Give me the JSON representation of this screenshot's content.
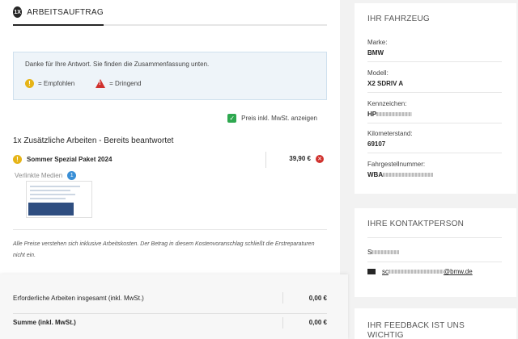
{
  "tab": {
    "badge": "1X",
    "label": "ARBEITSAUFTRAG"
  },
  "info": {
    "text": "Danke für Ihre Antwort. Sie finden die Zusammenfassung unten.",
    "legend_recommended": "= Empfohlen",
    "legend_urgent": "= Dringend"
  },
  "vat_toggle": {
    "label": "Preis inkl. MwSt. anzeigen",
    "checked": true
  },
  "section_title": "1x Zusätzliche Arbeiten - Bereits beantwortet",
  "item": {
    "name": "Sommer Spezial Paket 2024",
    "price": "39,90 €",
    "linked_media_label": "Verlinkte Medien",
    "linked_media_count": "1"
  },
  "footnote": "Alle Preise verstehen sich inklusive Arbeitskosten. Der Betrag in diesem Kostenvoranschlag schließt die Erstreparaturen nicht ein.",
  "totals": {
    "required_label": "Erforderliche Arbeiten insgesamt (inkl. MwSt.)",
    "required_value": "0,00 €",
    "sum_label": "Summe (inkl. MwSt.)",
    "sum_value": "0,00 €"
  },
  "vehicle": {
    "title": "IHR FAHRZEUG",
    "fields": [
      {
        "label": "Marke:",
        "value": "BMW"
      },
      {
        "label": "Modell:",
        "value": "X2 SDRIV A"
      },
      {
        "label": "Kennzeichen:",
        "value": "HP"
      },
      {
        "label": "Kilometerstand:",
        "value": "69107"
      },
      {
        "label": "Fahrgestellnummer:",
        "value": "WBA"
      }
    ]
  },
  "contact": {
    "title": "IHRE KONTAKTPERSON",
    "name": "S",
    "email_prefix": "sc",
    "email_suffix": "@bmw.de"
  },
  "feedback": {
    "title": "IHR FEEDBACK IST UNS WICHTIG"
  },
  "colors": {
    "warning": "#e6b417",
    "danger": "#d0312d",
    "success": "#2ea84f",
    "info_bg": "#eef4f9",
    "accent_dark": "#262626"
  }
}
